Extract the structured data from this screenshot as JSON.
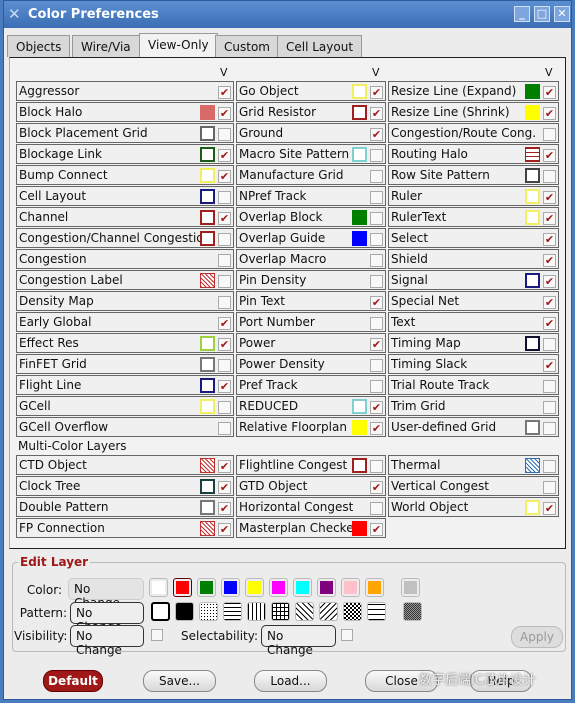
{
  "window": {
    "title": "Color Preferences",
    "controls": [
      "_",
      "□",
      "✕"
    ]
  },
  "tabs": [
    {
      "label": "Objects"
    },
    {
      "label": "Wire/Via"
    },
    {
      "label": "View-Only",
      "active": true
    },
    {
      "label": "Custom"
    },
    {
      "label": "Cell Layout"
    }
  ],
  "visibility_header": "V",
  "columns": [
    [
      {
        "label": "Aggressor",
        "swatch": {
          "type": "none"
        },
        "checked": true
      },
      {
        "label": "Block Halo",
        "swatch": {
          "type": "fill",
          "color": "#d96a6a"
        },
        "checked": true
      },
      {
        "label": "Block Placement Grid",
        "swatch": {
          "type": "outline",
          "color": "#666666"
        },
        "checked": false
      },
      {
        "label": "Blockage Link",
        "swatch": {
          "type": "outline",
          "color": "#1a5c1a"
        },
        "checked": true
      },
      {
        "label": "Bump Connect",
        "swatch": {
          "type": "outline",
          "color": "#f0f060"
        },
        "checked": true
      },
      {
        "label": "Cell Layout",
        "swatch": {
          "type": "outline",
          "color": "#1a1a80"
        },
        "checked": false
      },
      {
        "label": "Channel",
        "swatch": {
          "type": "outline",
          "color": "#a02020"
        },
        "checked": true
      },
      {
        "label": "Congestion/Channel Congestion",
        "swatch": {
          "type": "outline",
          "color": "#a02020"
        },
        "checked": false
      },
      {
        "label": "Congestion",
        "swatch": {
          "type": "none"
        },
        "checked": false
      },
      {
        "label": "Congestion Label",
        "swatch": {
          "type": "pattern",
          "color": "#c03030"
        },
        "checked": false
      },
      {
        "label": "Density Map",
        "swatch": {
          "type": "none"
        },
        "checked": false
      },
      {
        "label": "Early Global",
        "swatch": {
          "type": "none"
        },
        "checked": true
      },
      {
        "label": "Effect Res",
        "swatch": {
          "type": "outline",
          "color": "#a0d040"
        },
        "checked": true
      },
      {
        "label": "FinFET Grid",
        "swatch": {
          "type": "outline",
          "color": "#777777"
        },
        "checked": false
      },
      {
        "label": "Flight Line",
        "swatch": {
          "type": "outline",
          "color": "#1a1a80"
        },
        "checked": true
      },
      {
        "label": "GCell",
        "swatch": {
          "type": "outline",
          "color": "#f0f060"
        },
        "checked": false
      },
      {
        "label": "GCell Overflow",
        "swatch": {
          "type": "none"
        },
        "checked": false
      }
    ],
    [
      {
        "label": "Go Object",
        "swatch": {
          "type": "outline",
          "color": "#f0f060"
        },
        "checked": true
      },
      {
        "label": "Grid Resistor",
        "swatch": {
          "type": "outline",
          "color": "#a02020"
        },
        "checked": true
      },
      {
        "label": "Ground",
        "swatch": {
          "type": "none"
        },
        "checked": true
      },
      {
        "label": "Macro Site Pattern",
        "swatch": {
          "type": "outline",
          "color": "#80d0d0"
        },
        "checked": false
      },
      {
        "label": "Manufacture Grid",
        "swatch": {
          "type": "none"
        },
        "checked": false
      },
      {
        "label": "NPref Track",
        "swatch": {
          "type": "none"
        },
        "checked": false
      },
      {
        "label": "Overlap Block",
        "swatch": {
          "type": "fill",
          "color": "#008000"
        },
        "checked": false
      },
      {
        "label": "Overlap Guide",
        "swatch": {
          "type": "fill",
          "color": "#0000ff"
        },
        "checked": false
      },
      {
        "label": "Overlap Macro",
        "swatch": {
          "type": "none"
        },
        "checked": false
      },
      {
        "label": "Pin Density",
        "swatch": {
          "type": "none"
        },
        "checked": false
      },
      {
        "label": "Pin Text",
        "swatch": {
          "type": "none"
        },
        "checked": true
      },
      {
        "label": "Port Number",
        "swatch": {
          "type": "none"
        },
        "checked": false
      },
      {
        "label": "Power",
        "swatch": {
          "type": "none"
        },
        "checked": true
      },
      {
        "label": "Power Density",
        "swatch": {
          "type": "none"
        },
        "checked": false
      },
      {
        "label": "Pref Track",
        "swatch": {
          "type": "none"
        },
        "checked": false
      },
      {
        "label": "REDUCED",
        "swatch": {
          "type": "outline",
          "color": "#80d0d0"
        },
        "checked": true
      },
      {
        "label": "Relative Floorplan",
        "swatch": {
          "type": "fill",
          "color": "#ffff00"
        },
        "checked": true
      }
    ],
    [
      {
        "label": "Resize Line (Expand)",
        "swatch": {
          "type": "fill",
          "color": "#008000"
        },
        "checked": true
      },
      {
        "label": "Resize Line (Shrink)",
        "swatch": {
          "type": "fill",
          "color": "#ffff00"
        },
        "checked": true
      },
      {
        "label": "Congestion/Route Cong.",
        "swatch": {
          "type": "none"
        },
        "checked": false
      },
      {
        "label": "Routing Halo",
        "swatch": {
          "type": "brick",
          "color": "#a02020"
        },
        "checked": true
      },
      {
        "label": "Row Site Pattern",
        "swatch": {
          "type": "outline",
          "color": "#444444"
        },
        "checked": false
      },
      {
        "label": "Ruler",
        "swatch": {
          "type": "outline",
          "color": "#f0f060"
        },
        "checked": true
      },
      {
        "label": "RulerText",
        "swatch": {
          "type": "outline",
          "color": "#f0f060"
        },
        "checked": true
      },
      {
        "label": "Select",
        "swatch": {
          "type": "none"
        },
        "checked": true
      },
      {
        "label": "Shield",
        "swatch": {
          "type": "none"
        },
        "checked": true
      },
      {
        "label": "Signal",
        "swatch": {
          "type": "outline",
          "color": "#1a1a80"
        },
        "checked": true
      },
      {
        "label": "Special Net",
        "swatch": {
          "type": "none"
        },
        "checked": true
      },
      {
        "label": "Text",
        "swatch": {
          "type": "none"
        },
        "checked": true
      },
      {
        "label": "Timing Map",
        "swatch": {
          "type": "outline",
          "color": "#111133"
        },
        "checked": false
      },
      {
        "label": "Timing Slack",
        "swatch": {
          "type": "none"
        },
        "checked": true
      },
      {
        "label": "Trial Route Track",
        "swatch": {
          "type": "none"
        },
        "checked": false
      },
      {
        "label": "Trim Grid",
        "swatch": {
          "type": "none"
        },
        "checked": false
      },
      {
        "label": "User-defined Grid",
        "swatch": {
          "type": "outline",
          "color": "#777777"
        },
        "checked": false
      }
    ]
  ],
  "multi_color": {
    "title": "Multi-Color Layers",
    "columns": [
      [
        {
          "label": "CTD Object",
          "swatch": {
            "type": "pattern",
            "color": "#c03030"
          },
          "checked": true
        },
        {
          "label": "Clock Tree",
          "swatch": {
            "type": "outline",
            "color": "#1a4040"
          },
          "checked": true
        },
        {
          "label": "Double Pattern",
          "swatch": {
            "type": "outline",
            "color": "#777777"
          },
          "checked": true
        },
        {
          "label": "FP Connection",
          "swatch": {
            "type": "pattern",
            "color": "#c03030"
          },
          "checked": true
        }
      ],
      [
        {
          "label": "Flightline Congest",
          "swatch": {
            "type": "outline",
            "color": "#a02020"
          },
          "checked": false
        },
        {
          "label": "GTD Object",
          "swatch": {
            "type": "none"
          },
          "checked": true
        },
        {
          "label": "Horizontal Congest",
          "swatch": {
            "type": "none"
          },
          "checked": false
        },
        {
          "label": "Masterplan Checker",
          "swatch": {
            "type": "fill",
            "color": "#ff0000"
          },
          "checked": true
        }
      ],
      [
        {
          "label": "Thermal",
          "swatch": {
            "type": "pattern",
            "color": "#3070b0"
          },
          "checked": false
        },
        {
          "label": "Vertical Congest",
          "swatch": {
            "type": "none"
          },
          "checked": false
        },
        {
          "label": "World Object",
          "swatch": {
            "type": "outline",
            "color": "#f0f060"
          },
          "checked": true
        }
      ]
    ]
  },
  "edit_layer": {
    "title": "Edit Layer",
    "color_label": "Color:",
    "color_value": "No Change",
    "colors": [
      "#ffffff",
      "#ff0000",
      "#008000",
      "#0000ff",
      "#ffff00",
      "#ff00ff",
      "#00ffff",
      "#800080",
      "#ffc0cb",
      "#ffa500",
      "#c0c0c0"
    ],
    "selected_color": "#ff0000",
    "pattern_label": "Pattern:",
    "pattern_value": "No Change",
    "patterns": [
      "outline",
      "solid",
      "dots",
      "horizontal",
      "vertical",
      "grid",
      "diag-right",
      "diag-left",
      "checker",
      "brick",
      "dense"
    ],
    "visibility_label": "Visibility:",
    "visibility_value": "No Change",
    "selectability_label": "Selectability:",
    "selectability_value": "No Change",
    "apply_label": "Apply"
  },
  "buttons": {
    "default": "Default",
    "save": "Save...",
    "load": "Load...",
    "close": "Close",
    "help": "Help"
  },
  "watermark": "数字后端IC芯片设计"
}
